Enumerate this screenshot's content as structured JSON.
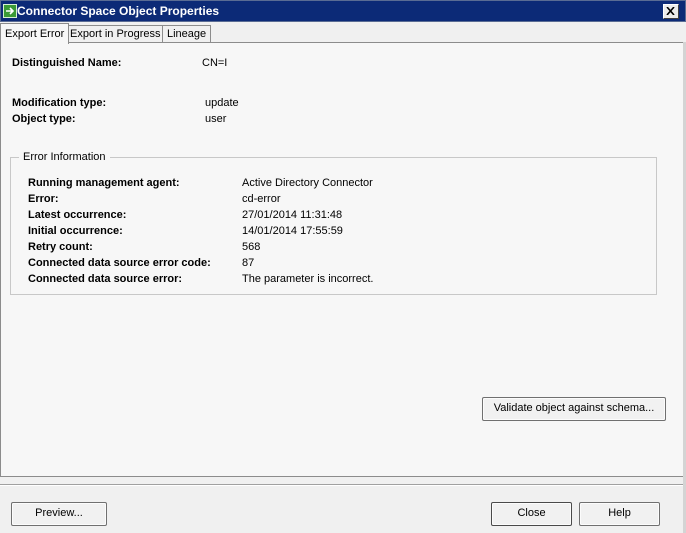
{
  "window": {
    "title": "Connector Space Object Properties",
    "icon": "connector-space-icon",
    "close_icon": "close-icon"
  },
  "tabs": [
    {
      "label": "Export Error",
      "active": true
    },
    {
      "label": "Export in Progress",
      "active": false
    },
    {
      "label": "Lineage",
      "active": false
    }
  ],
  "object": {
    "dn_label": "Distinguished Name:",
    "dn_value": "CN=I",
    "modification_label": "Modification type:",
    "modification_value": "update",
    "object_type_label": "Object type:",
    "object_type_value": "user"
  },
  "error_info": {
    "legend": "Error Information",
    "rows": [
      {
        "label": "Running management agent:",
        "value": "Active Directory Connector"
      },
      {
        "label": "Error:",
        "value": "cd-error"
      },
      {
        "label": "Latest occurrence:",
        "value": "27/01/2014 11:31:48"
      },
      {
        "label": "Initial occurrence:",
        "value": "14/01/2014 17:55:59"
      },
      {
        "label": "Retry count:",
        "value": "568"
      },
      {
        "label": "Connected data source error code:",
        "value": "87"
      },
      {
        "label": "Connected data source error:",
        "value": "The parameter is incorrect."
      }
    ]
  },
  "buttons": {
    "validate": "Validate object against schema...",
    "preview": "Preview...",
    "close": "Close",
    "help": "Help"
  }
}
